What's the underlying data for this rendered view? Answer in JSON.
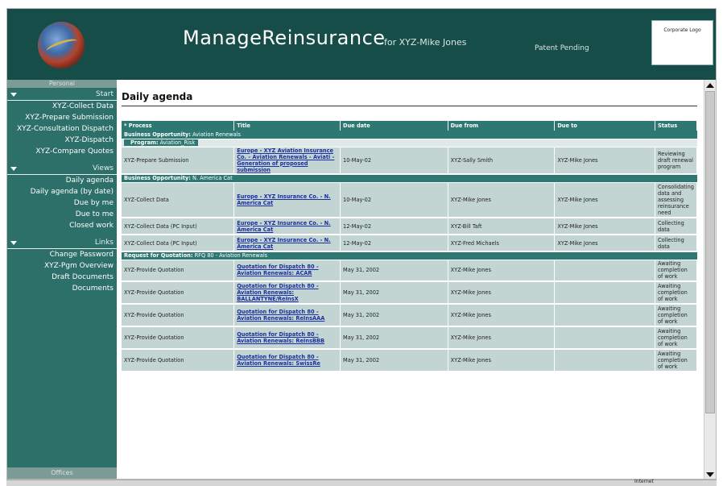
{
  "header": {
    "app_title": "ManageReinsurance",
    "for_user": "for XYZ-Mike Jones",
    "patent": "Patent Pending",
    "corporate_logo": "Corporate Logo"
  },
  "sidebar": {
    "personal_label": "Personal",
    "start": {
      "label": "Start",
      "items": [
        "XYZ-Collect Data",
        "XYZ-Prepare Submission",
        "XYZ-Consultation Dispatch",
        "XYZ-Dispatch",
        "XYZ-Compare Quotes"
      ]
    },
    "views": {
      "label": "Views",
      "items": [
        "Daily agenda",
        "Daily agenda (by date)",
        "Due by me",
        "Due to me",
        "Closed work"
      ]
    },
    "links": {
      "label": "Links",
      "items": [
        "Change Password",
        "XYZ-Pgm Overview",
        "Draft Documents",
        "Documents"
      ]
    },
    "offices_label": "Offices"
  },
  "main": {
    "title": "Daily agenda",
    "columns": [
      "* Process",
      "Title",
      "Due date",
      "Due from",
      "Due to",
      "Status"
    ],
    "groups": [
      {
        "header_bold": "Business Opportunity:",
        "header_text": " Aviation Renewals",
        "program_bold": "Program:",
        "program_text": " Aviation_Risk",
        "rows": [
          {
            "process": "XYZ-Prepare Submission",
            "title": "Europe - XYZ Aviation Insurance Co. - Aviation Renewals - Aviati - Generation of proposed submission",
            "due_date": "10-May-02",
            "due_from": "XYZ-Sally Smith",
            "due_to": "XYZ-Mike Jones",
            "status": "Reviewing draft renewal program"
          }
        ]
      },
      {
        "header_bold": "Business Opportunity:",
        "header_text": " N. America Cat",
        "rows": [
          {
            "process": "XYZ-Collect Data",
            "title": "Europe - XYZ Insurance Co. - N. America Cat",
            "due_date": "10-May-02",
            "due_from": "XYZ-Mike Jones",
            "due_to": "XYZ-Mike Jones",
            "status": "Consolidating data and assessing reinsurance need"
          },
          {
            "process": "XYZ-Collect Data (PC Input)",
            "title": "Europe - XYZ Insurance Co. - N. America Cat",
            "due_date": "12-May-02",
            "due_from": "XYZ-Bill Taft",
            "due_to": "XYZ-Mike Jones",
            "status": "Collecting data"
          },
          {
            "process": "XYZ-Collect Data (PC Input)",
            "title": "Europe - XYZ Insurance Co. - N. America Cat",
            "due_date": "12-May-02",
            "due_from": "XYZ-Fred Michaels",
            "due_to": "XYZ-Mike Jones",
            "status": "Collecting data"
          }
        ]
      },
      {
        "header_bold": "Request for Quotation:",
        "header_text": " RFQ 80 - Aviation Renewals",
        "rows": [
          {
            "process": "XYZ-Provide Quotation",
            "title": "Quotation for Dispatch 80 - Aviation Renewals: ACAR",
            "due_date": "May 31, 2002",
            "due_from": "XYZ-Mike Jones",
            "due_to": "",
            "status": "Awaiting completion of work"
          },
          {
            "process": "XYZ-Provide Quotation",
            "title": "Quotation for Dispatch 80 - Aviation Renewals: BALLANTYNE/ReInsX",
            "due_date": "May 31, 2002",
            "due_from": "XYZ-Mike Jones",
            "due_to": "",
            "status": "Awaiting completion of work"
          },
          {
            "process": "XYZ-Provide Quotation",
            "title": "Quotation for Dispatch 80 - Aviation Renewals: ReInsAAA",
            "due_date": "May 31, 2002",
            "due_from": "XYZ-Mike Jones",
            "due_to": "",
            "status": "Awaiting completion of work"
          },
          {
            "process": "XYZ-Provide Quotation",
            "title": "Quotation for Dispatch 80 - Aviation Renewals: ReInsBBB",
            "due_date": "May 31, 2002",
            "due_from": "XYZ-Mike Jones",
            "due_to": "",
            "status": "Awaiting completion of work"
          },
          {
            "process": "XYZ-Provide Quotation",
            "title": "Quotation for Dispatch 80 - Aviation Renewals: SwissRe",
            "due_date": "May 31, 2002",
            "due_from": "XYZ-Mike Jones",
            "due_to": "",
            "status": "Awaiting completion of work"
          }
        ]
      }
    ]
  },
  "statusbar": {
    "zone": "Internet"
  },
  "colors": {
    "header_bg": "#174d48",
    "sidebar_bg": "#2d6f69",
    "table_header": "#2e7873",
    "row_bg": "#c3d5d3",
    "link": "#1b2fa0"
  }
}
